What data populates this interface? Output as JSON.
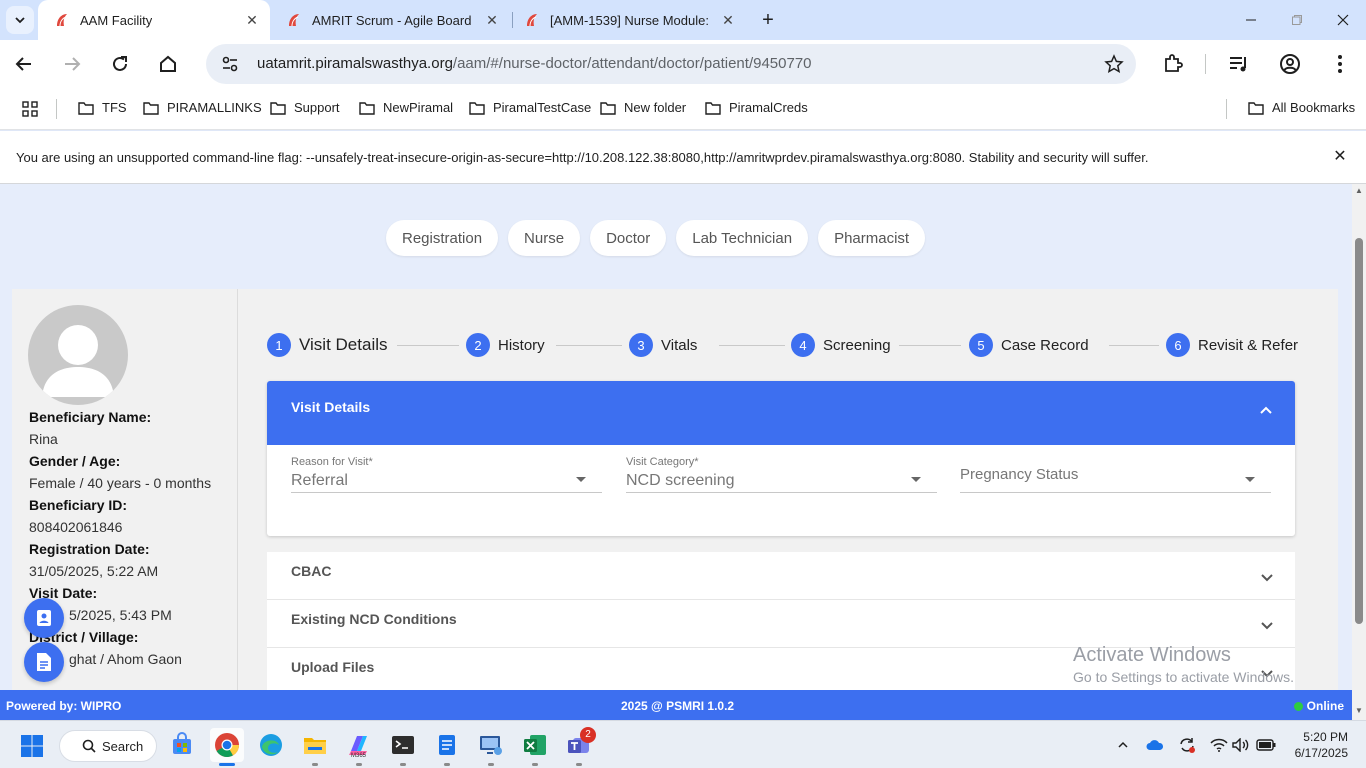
{
  "browser": {
    "tabs": [
      {
        "label": "AAM Facility",
        "active": true
      },
      {
        "label": "AMRIT Scrum - Agile Board",
        "active": false
      },
      {
        "label": "[AMM-1539] Nurse Module:",
        "active": false
      }
    ],
    "url_host": "uatamrit.piramalswasthya.org",
    "url_path": "/aam/#/nurse-doctor/attendant/doctor/patient/9450770",
    "bookmarks": [
      "TFS",
      "PIRAMALLINKS",
      "Support",
      "NewPiramal",
      "PiramalTestCase",
      "New folder",
      "PiramalCreds"
    ],
    "all_bookmarks": "All Bookmarks",
    "infobar": "You are using an unsupported command-line flag: --unsafely-treat-insecure-origin-as-secure=http://10.208.122.38:8080,http://amritwprdev.piramalswasthya.org:8080. Stability and security will suffer."
  },
  "roles": [
    "Registration",
    "Nurse",
    "Doctor",
    "Lab Technician",
    "Pharmacist"
  ],
  "beneficiary": {
    "name_label": "Beneficiary Name:",
    "name": "Rina",
    "gender_age_label": "Gender / Age:",
    "gender_age": "Female / 40 years - 0 months",
    "id_label": "Beneficiary ID:",
    "id": "808402061846",
    "reg_date_label": "Registration Date:",
    "reg_date": "31/05/2025, 5:22 AM",
    "visit_date_label": "Visit Date:",
    "visit_date": "5/2025, 5:43 PM",
    "district_label": "District / Village:",
    "district": "ghat / Ahom Gaon"
  },
  "steps": [
    {
      "num": "1",
      "label": "Visit Details"
    },
    {
      "num": "2",
      "label": "History"
    },
    {
      "num": "3",
      "label": "Vitals"
    },
    {
      "num": "4",
      "label": "Screening"
    },
    {
      "num": "5",
      "label": "Case Record"
    },
    {
      "num": "6",
      "label": "Revisit & Refer"
    }
  ],
  "visit_details": {
    "title": "Visit Details",
    "reason_label": "Reason for Visit",
    "reason_value": "Referral",
    "category_label": "Visit Category",
    "category_value": "NCD screening",
    "required_mark": "*",
    "pregnancy_placeholder": "Pregnancy Status"
  },
  "accordions": [
    "CBAC",
    "Existing NCD Conditions",
    "Upload Files"
  ],
  "watermark": {
    "line1": "Activate Windows",
    "line2": "Go to Settings to activate Windows."
  },
  "footer": {
    "left": "Powered by: WIPRO",
    "center": "2025 @ PSMRI 1.0.2",
    "right": "Online"
  },
  "taskbar": {
    "search": "Search",
    "time": "5:20 PM",
    "date": "6/17/2025",
    "teams_badge": "2",
    "m365_label": "M365"
  },
  "colors": {
    "primary": "#3d6ff0",
    "online": "#2ecc40"
  }
}
